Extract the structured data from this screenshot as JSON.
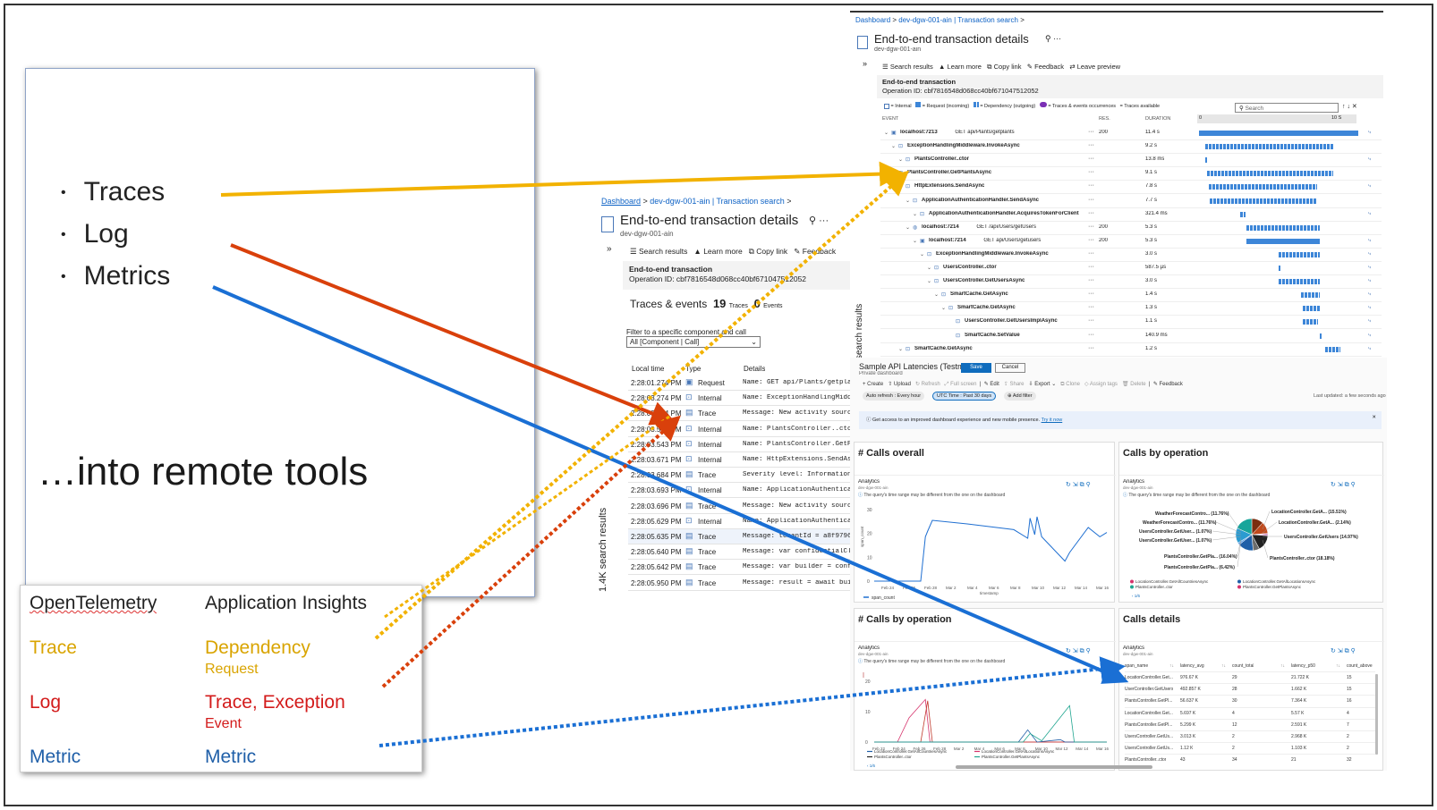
{
  "slide": {
    "bullets": [
      "Traces",
      "Log",
      "Metrics"
    ],
    "headline": "…into remote tools",
    "mapping": {
      "left_header": "OpenTelemetry",
      "right_header": "Application Insights",
      "rows": [
        {
          "left": "Trace",
          "right": "Dependency",
          "right_sub": "Request",
          "color": "#d9a400"
        },
        {
          "left": "Log",
          "right": "Trace, Exception",
          "right_sub": "Event",
          "color": "#d31b1b"
        },
        {
          "left": "Metric",
          "right": "Metric",
          "right_sub": "",
          "color": "#1f5fa8"
        }
      ]
    },
    "arrow_colors": {
      "traces": "#f2b200",
      "log": "#d9400b",
      "metrics": "#1a6fd4"
    }
  },
  "tx_back": {
    "breadcrumb": [
      "Dashboard",
      "dev-dgw-001-ain | Transaction search"
    ],
    "title": "End-to-end transaction details",
    "subtitle": "dev-dgw-001-ain",
    "toolbar": [
      "Search results",
      "Learn more",
      "Copy link",
      "Feedback"
    ],
    "section_title": "End-to-end transaction",
    "operation": "Operation ID: cbf7816548d068cc40bf671047512052",
    "traces_label": "Traces & events",
    "traces_count": "19",
    "traces_unit": "Traces",
    "events_count": "0",
    "events_unit": "Events",
    "filter_label": "Filter to a specific component and call",
    "filter_value": "All [Component | Call]",
    "side_label": "1.4K search results",
    "columns": [
      "Local time",
      "Type",
      "Details"
    ],
    "rows": [
      [
        "2:28:01.274 PM",
        "Request",
        "Name: GET api/Plants/getplants"
      ],
      [
        "2:28:03.274 PM",
        "Internal",
        "Name: ExceptionHandlingMiddlew"
      ],
      [
        "2:28:03.274 PM",
        "Trace",
        "Message: New activity source c"
      ],
      [
        "2:28:03.543 PM",
        "Internal",
        "Name: PlantsController..ctor,"
      ],
      [
        "2:28:03.543 PM",
        "Internal",
        "Name: PlantsController.GetPla"
      ],
      [
        "2:28:03.671 PM",
        "Internal",
        "Name: HttpExtensions.SendAsyn"
      ],
      [
        "2:28:03.684 PM",
        "Trace",
        "Severity level: Information, M"
      ],
      [
        "2:28:03.693 PM",
        "Internal",
        "Name: ApplicationAuthenticati"
      ],
      [
        "2:28:03.696 PM",
        "Trace",
        "Message: New activity source c"
      ],
      [
        "2:28:05.629 PM",
        "Internal",
        "Name: ApplicationAuthenticati"
      ],
      [
        "2:28:05.635 PM",
        "Trace",
        "Message: tenantId = a8f97966-c"
      ],
      [
        "2:28:05.640 PM",
        "Trace",
        "Message: var confidentialClie"
      ],
      [
        "2:28:05.642 PM",
        "Trace",
        "Message: var builder = confide"
      ],
      [
        "2:28:05.950 PM",
        "Trace",
        "Message: result = await builde"
      ]
    ]
  },
  "tx_front": {
    "breadcrumb": [
      "Dashboard",
      "dev-dgw-001-ain | Transaction search"
    ],
    "title": "End-to-end transaction details",
    "subtitle": "dev-dgw-001-ain",
    "toolbar": [
      "Search results",
      "Learn more",
      "Copy link",
      "Feedback",
      "Leave preview"
    ],
    "section_title": "End-to-end transaction",
    "operation": "Operation ID: cbf7816548d068cc40bf671047512052",
    "legend": [
      "= Internal",
      "= Request (incoming)",
      "= Dependency (outgoing)",
      "= Traces & events occurrences",
      "= Traces available"
    ],
    "search_placeholder": "Search",
    "columns": [
      "EVENT",
      "RES.",
      "DURATION"
    ],
    "timeline_ticks": [
      "0",
      "10 S"
    ],
    "side_label": "search results",
    "rows": [
      {
        "indent": 0,
        "name": "localhost:7213",
        "op": "GET api/Plants/getplants",
        "res": "200",
        "dur": "11.4 s",
        "start": 0,
        "width": 1,
        "kind": "req"
      },
      {
        "indent": 1,
        "name": "ExceptionHandlingMiddleware.InvokeAsync",
        "op": "",
        "res": "",
        "dur": "9.2 s",
        "start": 0.04,
        "width": 0.8,
        "kind": "int"
      },
      {
        "indent": 2,
        "name": "PlantsController..ctor",
        "op": "",
        "res": "",
        "dur": "13.8 ms",
        "start": 0.04,
        "width": 0.003,
        "kind": "int"
      },
      {
        "indent": 1,
        "name": "PlantsController.GetPlantsAsync",
        "op": "",
        "res": "",
        "dur": "9.1 s",
        "start": 0.05,
        "width": 0.79,
        "kind": "int"
      },
      {
        "indent": 2,
        "name": "HttpExtensions.SendAsync",
        "op": "",
        "res": "",
        "dur": "7.8 s",
        "start": 0.06,
        "width": 0.68,
        "kind": "int"
      },
      {
        "indent": 3,
        "name": "ApplicationAuthenticationHandler.SendAsync",
        "op": "",
        "res": "",
        "dur": "7.7 s",
        "start": 0.07,
        "width": 0.67,
        "kind": "int"
      },
      {
        "indent": 4,
        "name": "ApplicationAuthenticationHandler.AcquiresTokenForClient",
        "op": "",
        "res": "",
        "dur": "321.4 ms",
        "start": 0.26,
        "width": 0.03,
        "kind": "int"
      },
      {
        "indent": 3,
        "name": "localhost:7214",
        "op": "GET /api/Users/getUsers",
        "res": "200",
        "dur": "5.3 s",
        "start": 0.3,
        "width": 0.46,
        "kind": "dep"
      },
      {
        "indent": 4,
        "name": "localhost:7214",
        "op": "GET api/Users/getusers",
        "res": "200",
        "dur": "5.3 s",
        "start": 0.3,
        "width": 0.46,
        "kind": "req"
      },
      {
        "indent": 5,
        "name": "ExceptionHandlingMiddleware.InvokeAsync",
        "op": "",
        "res": "",
        "dur": "3.0 s",
        "start": 0.5,
        "width": 0.26,
        "kind": "int"
      },
      {
        "indent": 6,
        "name": "UsersController..ctor",
        "op": "",
        "res": "",
        "dur": "587.5 µs",
        "start": 0.5,
        "width": 0.003,
        "kind": "int"
      },
      {
        "indent": 6,
        "name": "UsersController.GetUsersAsync",
        "op": "",
        "res": "",
        "dur": "3.0 s",
        "start": 0.5,
        "width": 0.26,
        "kind": "int"
      },
      {
        "indent": 7,
        "name": "SmartCache.GetAsync",
        "op": "",
        "res": "",
        "dur": "1.4 s",
        "start": 0.64,
        "width": 0.12,
        "kind": "int"
      },
      {
        "indent": 8,
        "name": "SmartCache.GetAsync",
        "op": "",
        "res": "",
        "dur": "1.3 s",
        "start": 0.65,
        "width": 0.11,
        "kind": "int"
      },
      {
        "indent": 9,
        "name": "UsersController.GetUsersImplAsync",
        "op": "",
        "res": "",
        "dur": "1.1 s",
        "start": 0.65,
        "width": 0.1,
        "kind": "int"
      },
      {
        "indent": 9,
        "name": "SmartCache.SetValue",
        "op": "",
        "res": "",
        "dur": "140.9 ms",
        "start": 0.76,
        "width": 0.012,
        "kind": "int"
      },
      {
        "indent": 2,
        "name": "SmartCache.GetAsync",
        "op": "",
        "res": "",
        "dur": "1.2 s",
        "start": 0.79,
        "width": 0.1,
        "kind": "int"
      }
    ]
  },
  "dashboard": {
    "title": "Sample API Latencies (Testms)",
    "subtitle": "Private dashboard",
    "save": "Save",
    "cancel": "Cancel",
    "toolbar": [
      "Create",
      "Upload",
      "Refresh",
      "Full screen",
      "Edit",
      "Share",
      "Export",
      "Clone",
      "Assign tags",
      "Delete",
      "Feedback"
    ],
    "auto_refresh": "Auto refresh : Every hour",
    "time_range": "UTC Time : Past 30 days",
    "add_filter": "Add filter",
    "last_updated": "Last updated: a few seconds ago",
    "banner": "Get access to an improved dashboard experience and new mobile presence.",
    "banner_link": "Try it now",
    "tiles": [
      {
        "title": "# Calls overall",
        "kind": "line"
      },
      {
        "title": "Calls by operation",
        "kind": "pie"
      },
      {
        "title": "# Calls by operation",
        "kind": "multiline"
      },
      {
        "title": "Calls details",
        "kind": "table"
      }
    ],
    "analytics_label": "Analytics",
    "analytics_sub": "dev-dgw-001-ain",
    "warning": "The query's time range may be different from the one on the dashboard",
    "line_x_ticks": [
      "Feb 24",
      "Feb 26",
      "Feb 28",
      "Mar 2",
      "Mar 4",
      "Mar 6",
      "Mar 8",
      "Mar 10",
      "Mar 12",
      "Mar 14",
      "Mar 16"
    ],
    "line_y_ticks": [
      "30",
      "20",
      "10",
      "0"
    ],
    "line_xlabel": "timestamp",
    "line_ylabel": "span_count",
    "line_legend": "span_count",
    "multi_x_ticks": [
      "Feb 22",
      "Feb 24",
      "Feb 26",
      "Feb 28",
      "Mar 2",
      "Mar 4",
      "Mar 6",
      "Mar 8",
      "Mar 10",
      "Mar 12",
      "Mar 14",
      "Mar 16"
    ],
    "multi_y_ticks": [
      "20",
      "10",
      "0"
    ],
    "multi_legend": [
      "LocationController.GetAllCountriesAsync",
      "LocationController.GetAllLocationsAsync",
      "PlantsController..ctor",
      "PlantsController.GetPlantsAsync"
    ],
    "pager": "1/6",
    "pie_labels": [
      {
        "label": "WeatherForecastContro... (11.76%)",
        "side": "left",
        "pct": 11.76,
        "color": "#7b2e10"
      },
      {
        "label": "WeatherForecastContro... (11.76%)",
        "side": "left",
        "pct": 11.76,
        "color": "#c14a1c"
      },
      {
        "label": "UsersController.GetUser... (1.07%)",
        "side": "left",
        "pct": 1.07,
        "color": "#9d2f8c"
      },
      {
        "label": "UsersController.GetUser... (1.07%)",
        "side": "left",
        "pct": 1.07,
        "color": "#d67ac8"
      },
      {
        "label": "PlantsController.GetPla... (16.04%)",
        "side": "left",
        "pct": 16.04,
        "color": "#222222"
      },
      {
        "label": "PlantsController.GetPla... (6.42%)",
        "side": "left",
        "pct": 6.42,
        "color": "#6c6c6c"
      },
      {
        "label": "LocationController.GetA... (15.51%)",
        "side": "right",
        "pct": 15.51,
        "color": "#1f5fa8"
      },
      {
        "label": "LocationController.GetA... (2.14%)",
        "side": "right",
        "pct": 2.14,
        "color": "#62a2e8"
      },
      {
        "label": "UsersController.GetUsers (14.97%)",
        "side": "right",
        "pct": 14.97,
        "color": "#2b9bd1"
      },
      {
        "label": "PlantsController..ctor (18.18%)",
        "side": "right",
        "pct": 18.18,
        "color": "#17a59b"
      }
    ],
    "pie_legend": [
      "LocationController.GetAllCountriesAsync",
      "LocationController.GetAllLocationsAsync",
      "PlantsController..ctor",
      "PlantsController.GetPlantsAsync"
    ],
    "table_columns": [
      "span_name",
      "latency_avg",
      "count_total",
      "latency_p50",
      "count_above"
    ],
    "table_rows": [
      [
        "LocationController.Get...",
        "976.67 K",
        "29",
        "21.722 K",
        "15"
      ],
      [
        "UserController.GetUsers",
        "492.857 K",
        "28",
        "1.662 K",
        "15"
      ],
      [
        "PlantsController.GetPl...",
        "56.637 K",
        "30",
        "7.364 K",
        "16"
      ],
      [
        "LocationController.Get...",
        "5.697 K",
        "4",
        "5.57 K",
        "4"
      ],
      [
        "PlantsController.GetPl...",
        "5.299 K",
        "12",
        "2.591 K",
        "7"
      ],
      [
        "UsersController.GetUs...",
        "3.013 K",
        "2",
        "2.968 K",
        "2"
      ],
      [
        "UsersController.GetUs...",
        "1.12 K",
        "2",
        "1.103 K",
        "2"
      ],
      [
        "PlantsController..ctor",
        "43",
        "34",
        "21",
        "32"
      ]
    ]
  }
}
